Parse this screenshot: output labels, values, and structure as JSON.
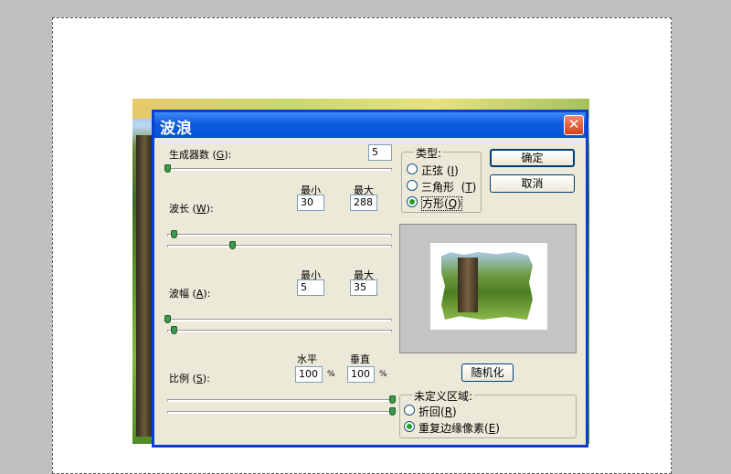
{
  "dialog": {
    "title": "波浪",
    "generators": {
      "label": "生成器数",
      "mnemonic": "G",
      "value": "5"
    },
    "wavelength": {
      "label": "波长",
      "mnemonic": "W",
      "min_header": "最小",
      "max_header": "最大",
      "min": "30",
      "max": "288"
    },
    "amplitude": {
      "label": "波幅",
      "mnemonic": "A",
      "min_header": "最小",
      "max_header": "最大",
      "min": "5",
      "max": "35"
    },
    "scale": {
      "label": "比例",
      "mnemonic": "S",
      "h_header": "水平",
      "v_header": "垂直",
      "h": "100",
      "v": "100",
      "unit": "%"
    },
    "type_group": {
      "title": "类型:",
      "options": [
        {
          "label": "正弦",
          "mnemonic": "I",
          "checked": false
        },
        {
          "label": "三角形",
          "mnemonic": "T",
          "checked": false
        },
        {
          "label": "方形",
          "mnemonic": "Q",
          "checked": true
        }
      ]
    },
    "ok_label": "确定",
    "cancel_label": "取消",
    "randomize_label": "随机化",
    "undefined_group": {
      "title": "未定义区域:",
      "options": [
        {
          "label": "折回",
          "mnemonic": "R",
          "checked": false
        },
        {
          "label": "重复边缘像素",
          "mnemonic": "E",
          "checked": true
        }
      ]
    },
    "close_label": "✕"
  },
  "sliders": {
    "generators": 0.0,
    "wavelength_min": 0.03,
    "wavelength_max": 0.29,
    "amplitude_min": 0.0,
    "amplitude_max": 0.03,
    "scale_h": 1.0,
    "scale_v": 1.0
  },
  "colors": {
    "title_bar": "#0a5ae0",
    "dialog_bg": "#ece9d8",
    "close": "#d9401a",
    "canvas_border": "#555555"
  }
}
